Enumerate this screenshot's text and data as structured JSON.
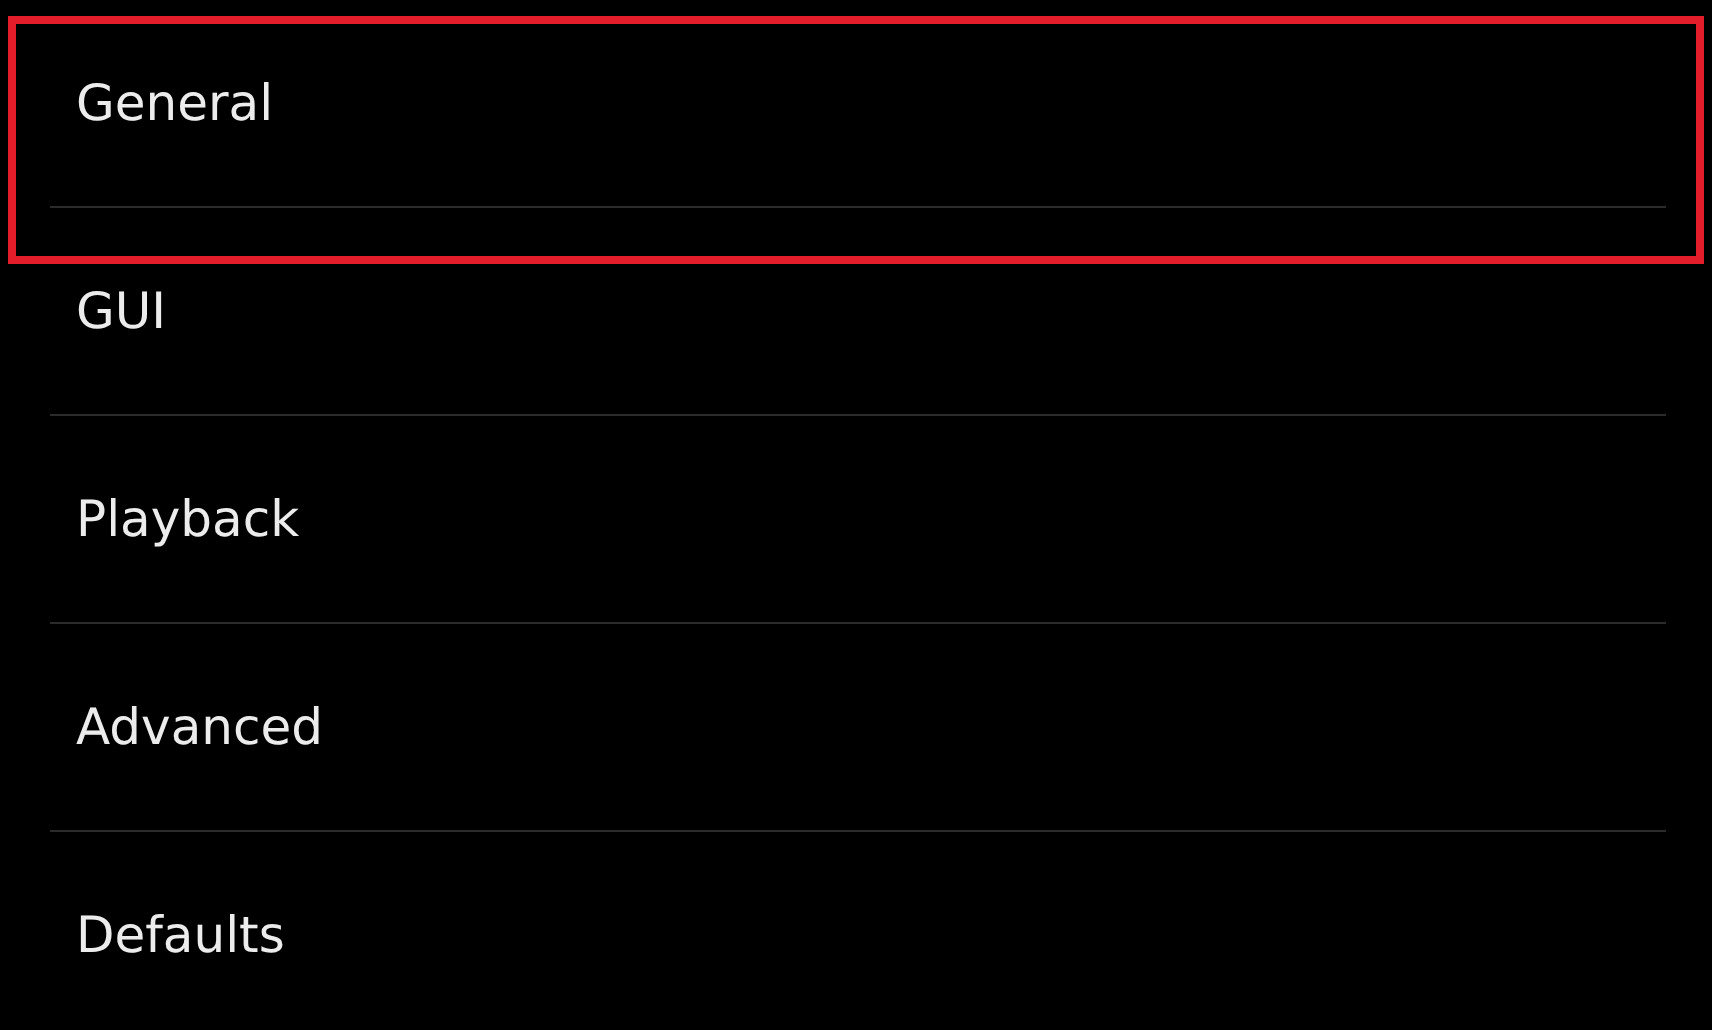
{
  "items": [
    {
      "label": "General",
      "selected": true
    },
    {
      "label": "GUI",
      "selected": false
    },
    {
      "label": "Playback",
      "selected": false
    },
    {
      "label": "Advanced",
      "selected": false
    },
    {
      "label": "Defaults",
      "selected": false
    }
  ]
}
